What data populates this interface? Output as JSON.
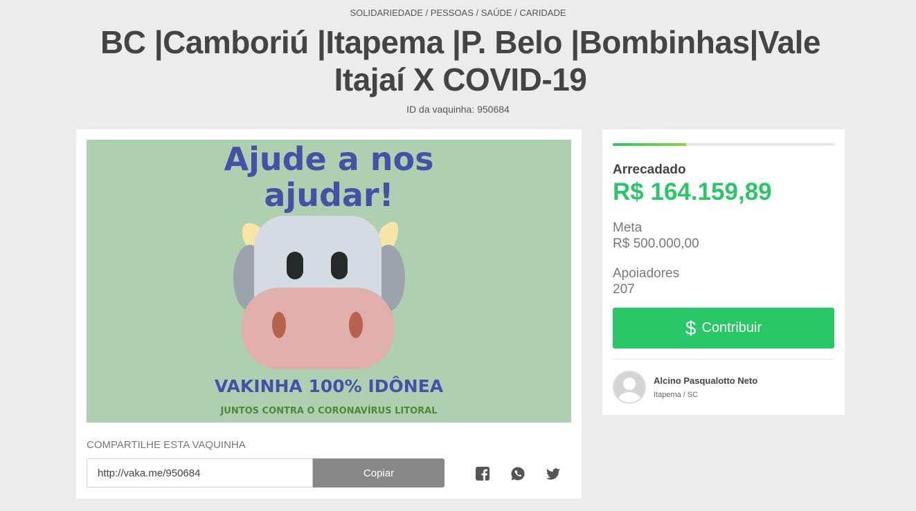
{
  "header": {
    "categories": "SOLIDARIEDADE / PESSOAS / SAÚDE / CARIDADE",
    "title": "BC |Camboriú |Itapema |P. Belo |Bombinhas|Vale Itajaí X COVID-19",
    "campaign_id": "ID da vaquinha: 950684"
  },
  "banner": {
    "headline_line1": "Ajude a nos",
    "headline_line2": "ajudar!",
    "tagline": "VAKINHA 100% IDÔNEA",
    "subtagline": "JUNTOS CONTRA O CORONAVÍRUS LITORAL",
    "background_color": "#aed0b0",
    "icon": "cow-face-illustration"
  },
  "share": {
    "label": "COMPARTILHE ESTA VAQUINHA",
    "url": "http://vaka.me/950684",
    "copy_label": "Copiar",
    "networks": [
      "facebook-icon",
      "whatsapp-icon",
      "twitter-icon"
    ]
  },
  "stats": {
    "progress_percent": 33,
    "raised_label": "Arrecadado",
    "raised_value": "R$ 164.159,89",
    "goal_label": "Meta",
    "goal_value": "R$ 500.000,00",
    "supporters_label": "Apoiadores",
    "supporters_value": "207",
    "contribute_label": "Contribuir",
    "accent_color": "#2ac768"
  },
  "owner": {
    "name": "Alcino Pasqualotto Neto",
    "location": "Itapema / SC"
  }
}
